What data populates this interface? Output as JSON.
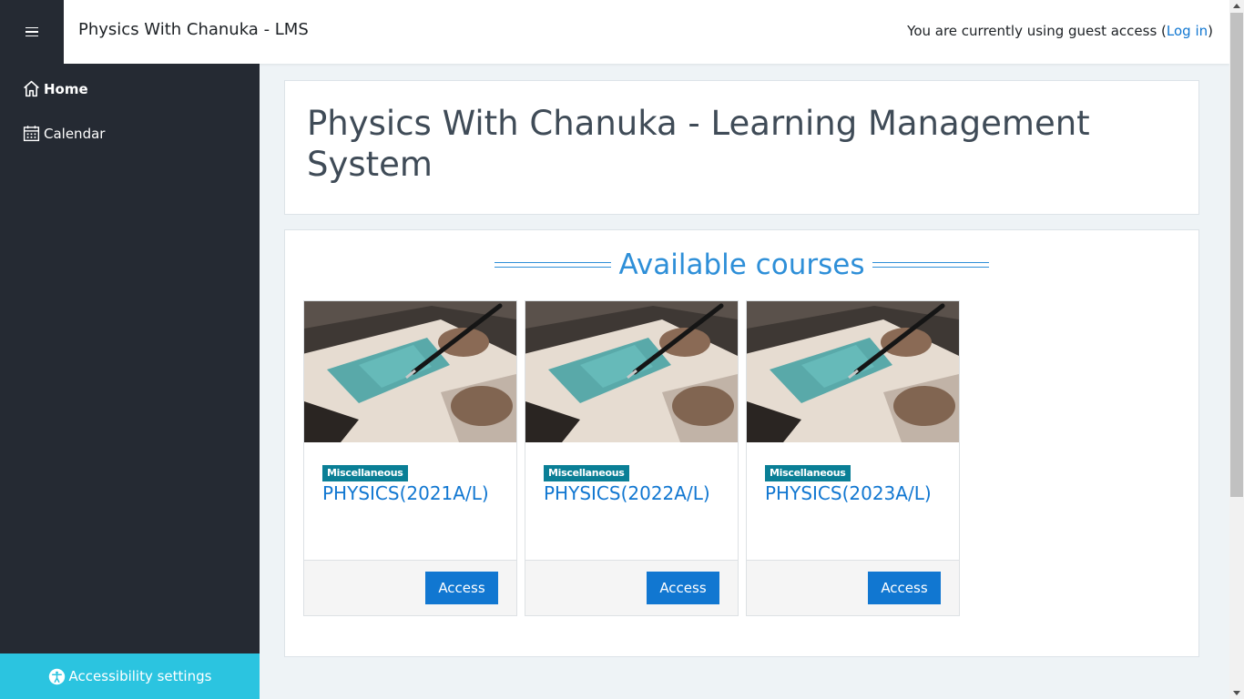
{
  "header": {
    "site_name": "Physics With Chanuka - LMS",
    "guest_text": "You are currently using guest access (",
    "login_label": "Log in",
    "guest_close": ")"
  },
  "sidebar": {
    "items": [
      {
        "label": "Home",
        "icon": "home-icon",
        "active": true
      },
      {
        "label": "Calendar",
        "icon": "calendar-icon",
        "active": false
      }
    ],
    "accessibility_label": "Accessibility settings"
  },
  "main": {
    "page_title": "Physics With Chanuka - Learning Management System",
    "section_heading": "Available courses",
    "courses": [
      {
        "category": "Miscellaneous",
        "name": "PHYSICS(2021A/L)",
        "button": "Access"
      },
      {
        "category": "Miscellaneous",
        "name": "PHYSICS(2022A/L)",
        "button": "Access"
      },
      {
        "category": "Miscellaneous",
        "name": "PHYSICS(2023A/L)",
        "button": "Access"
      }
    ]
  },
  "colors": {
    "sidebar_bg": "#252a33",
    "accent_link": "#1177d1",
    "heading_blue": "#2e8fd8",
    "badge_teal": "#0a7f96",
    "a11y_bar": "#2bc4e0"
  }
}
